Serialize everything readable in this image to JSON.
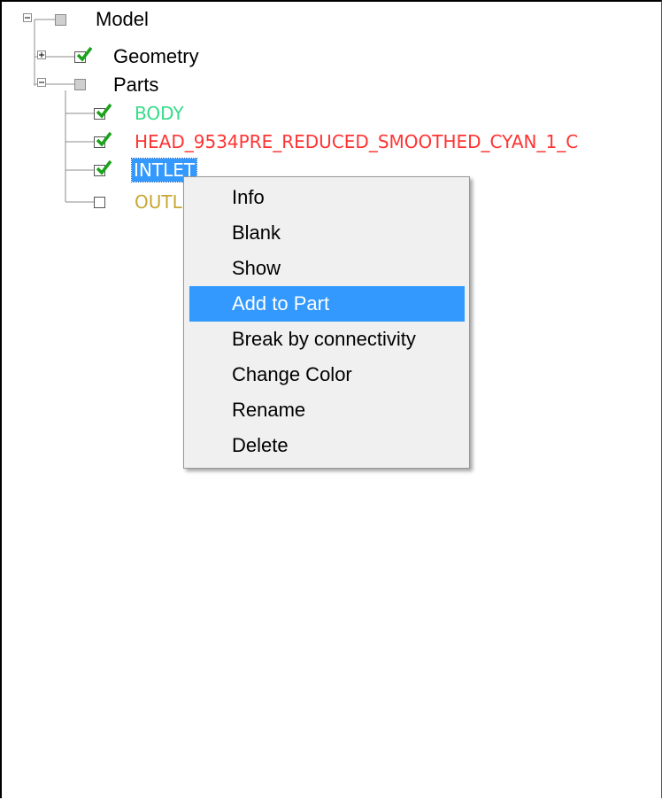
{
  "tree": {
    "root": {
      "label": "Model",
      "expanded": true,
      "checked": "partial"
    },
    "geometry": {
      "label": "Geometry",
      "expanded": false,
      "checked": true
    },
    "parts": {
      "label": "Parts",
      "expanded": true,
      "checked": "partial",
      "items": [
        {
          "label": "BODY",
          "color": "#33dd88",
          "checked": true,
          "selected": false
        },
        {
          "label": "HEAD_9534PRE_REDUCED_SMOOTHED_CYAN_1_C",
          "color": "#ff3333",
          "checked": true,
          "selected": false
        },
        {
          "label": "INTLET",
          "color": "#ffffff",
          "checked": true,
          "selected": true
        },
        {
          "label": "OUTL",
          "color": "#c8a832",
          "checked": false,
          "selected": false
        }
      ]
    }
  },
  "context_menu": {
    "highlighted": "Add to Part",
    "items": [
      {
        "label": "Info"
      },
      {
        "label": "Blank"
      },
      {
        "label": "Show"
      },
      {
        "label": "Add to Part"
      },
      {
        "label": "Break by connectivity"
      },
      {
        "label": "Change Color"
      },
      {
        "label": "Rename"
      },
      {
        "label": "Delete"
      }
    ]
  },
  "colors": {
    "selection": "#3399ff",
    "check_green": "#1aa31a",
    "menu_bg": "#f0f0f0"
  }
}
